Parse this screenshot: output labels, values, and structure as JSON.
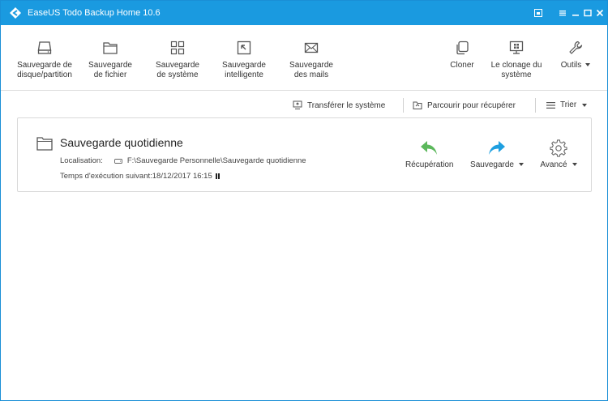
{
  "window": {
    "title": "EaseUS Todo Backup Home 10.6"
  },
  "toolbar": {
    "disk_backup": "Sauvegarde de\ndisque/partition",
    "file_backup": "Sauvegarde\nde fichier",
    "system_backup": "Sauvegarde\nde système",
    "smart_backup": "Sauvegarde\nintelligente",
    "mail_backup": "Sauvegarde\ndes mails",
    "clone": "Cloner",
    "system_clone": "Le clonage du\nsystème",
    "tools": "Outils"
  },
  "actionbar": {
    "transfer": "Transférer le système",
    "browse": "Parcourir pour récupérer",
    "sort": "Trier"
  },
  "task": {
    "name": "Sauvegarde quotidienne",
    "location_label": "Localisation:",
    "location_path": "F:\\Sauvegarde Personnelle\\Sauvegarde quotidienne",
    "next_run": "Temps d'exécution suivant:18/12/2017 16:15",
    "recover": "Récupération",
    "backup": "Sauvegarde",
    "advanced": "Avancé"
  },
  "colors": {
    "titlebar": "#1a9ae0",
    "recover_arrow": "#5cb85c",
    "backup_arrow": "#1e9fe0"
  }
}
